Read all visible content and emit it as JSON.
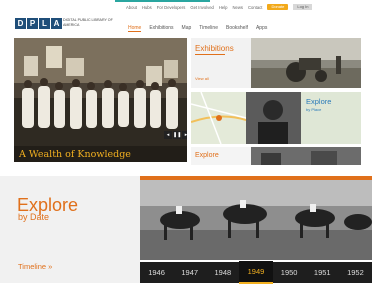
{
  "utility_nav": {
    "items": [
      "About",
      "Hubs",
      "For Developers",
      "Get Involved",
      "Help",
      "News",
      "Contact"
    ],
    "donate": "Donate",
    "login": "Log In"
  },
  "logo": {
    "letters": [
      "D",
      "P",
      "L",
      "A"
    ],
    "subtitle": "DIGITAL PUBLIC LIBRARY OF AMERICA"
  },
  "main_nav": [
    "Home",
    "Exhibitions",
    "Map",
    "Timeline",
    "Bookshelf",
    "Apps"
  ],
  "hero": {
    "title": "A Wealth of Knowledge"
  },
  "tiles": {
    "exhibitions": {
      "title": "Exhibitions",
      "more": "View all"
    },
    "place": {
      "title": "Explore",
      "subtitle": "by Place"
    },
    "bottom": {
      "title": "Explore"
    }
  },
  "date_panel": {
    "title": "Explore",
    "subtitle": "by Date",
    "link": "Timeline »"
  },
  "timeline_years": [
    "1946",
    "1947",
    "1948",
    "1949",
    "1950",
    "1951",
    "1952"
  ],
  "active_year": "1949",
  "colors": {
    "accent": "#e0701b",
    "brand": "#1f4e79",
    "year_highlight": "#f2b020",
    "place_blue": "#2b7bb9"
  }
}
